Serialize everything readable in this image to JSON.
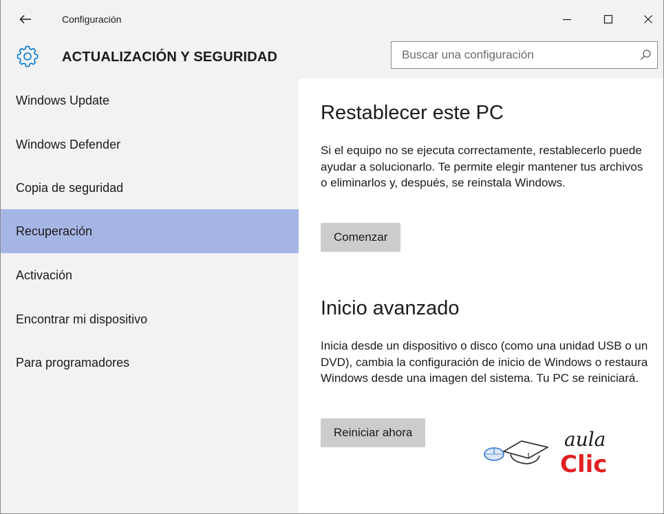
{
  "window": {
    "title": "Configuración",
    "icons": {
      "back": "back-arrow-icon",
      "minimize": "minimize-icon",
      "maximize": "maximize-icon",
      "close": "close-icon"
    }
  },
  "header": {
    "icon": "gear-icon",
    "title": "ACTUALIZACIÓN Y SEGURIDAD",
    "search": {
      "placeholder": "Buscar una configuración",
      "value": "",
      "icon": "search-icon"
    }
  },
  "sidebar": {
    "items": [
      {
        "label": "Windows Update",
        "active": false
      },
      {
        "label": "Windows Defender",
        "active": false
      },
      {
        "label": "Copia de seguridad",
        "active": false
      },
      {
        "label": "Recuperación",
        "active": true
      },
      {
        "label": "Activación",
        "active": false
      },
      {
        "label": "Encontrar mi dispositivo",
        "active": false
      },
      {
        "label": "Para programadores",
        "active": false
      }
    ]
  },
  "main": {
    "reset": {
      "heading": "Restablecer este PC",
      "description": "Si el equipo no se ejecuta correctamente, restablecerlo puede ayudar a solucionarlo. Te permite elegir mantener tus archivos o eliminarlos y, después, se reinstala Windows.",
      "button": "Comenzar"
    },
    "advanced": {
      "heading": "Inicio avanzado",
      "description": "Inicia desde un dispositivo o disco (como una unidad USB o un DVD), cambia la configuración de inicio de Windows o restaura Windows desde una imagen del sistema. Tu PC se reiniciará.",
      "button": "Reiniciar ahora"
    }
  },
  "watermark": {
    "line1": "aula",
    "line2": "Clic",
    "icon": "mouse-mortarboard-icon"
  },
  "colors": {
    "chrome": "#f2f2f2",
    "active_nav": "#a6b6e4",
    "button": "#cccccc",
    "accent": "#0078d7",
    "logo_red": "#e02020"
  }
}
